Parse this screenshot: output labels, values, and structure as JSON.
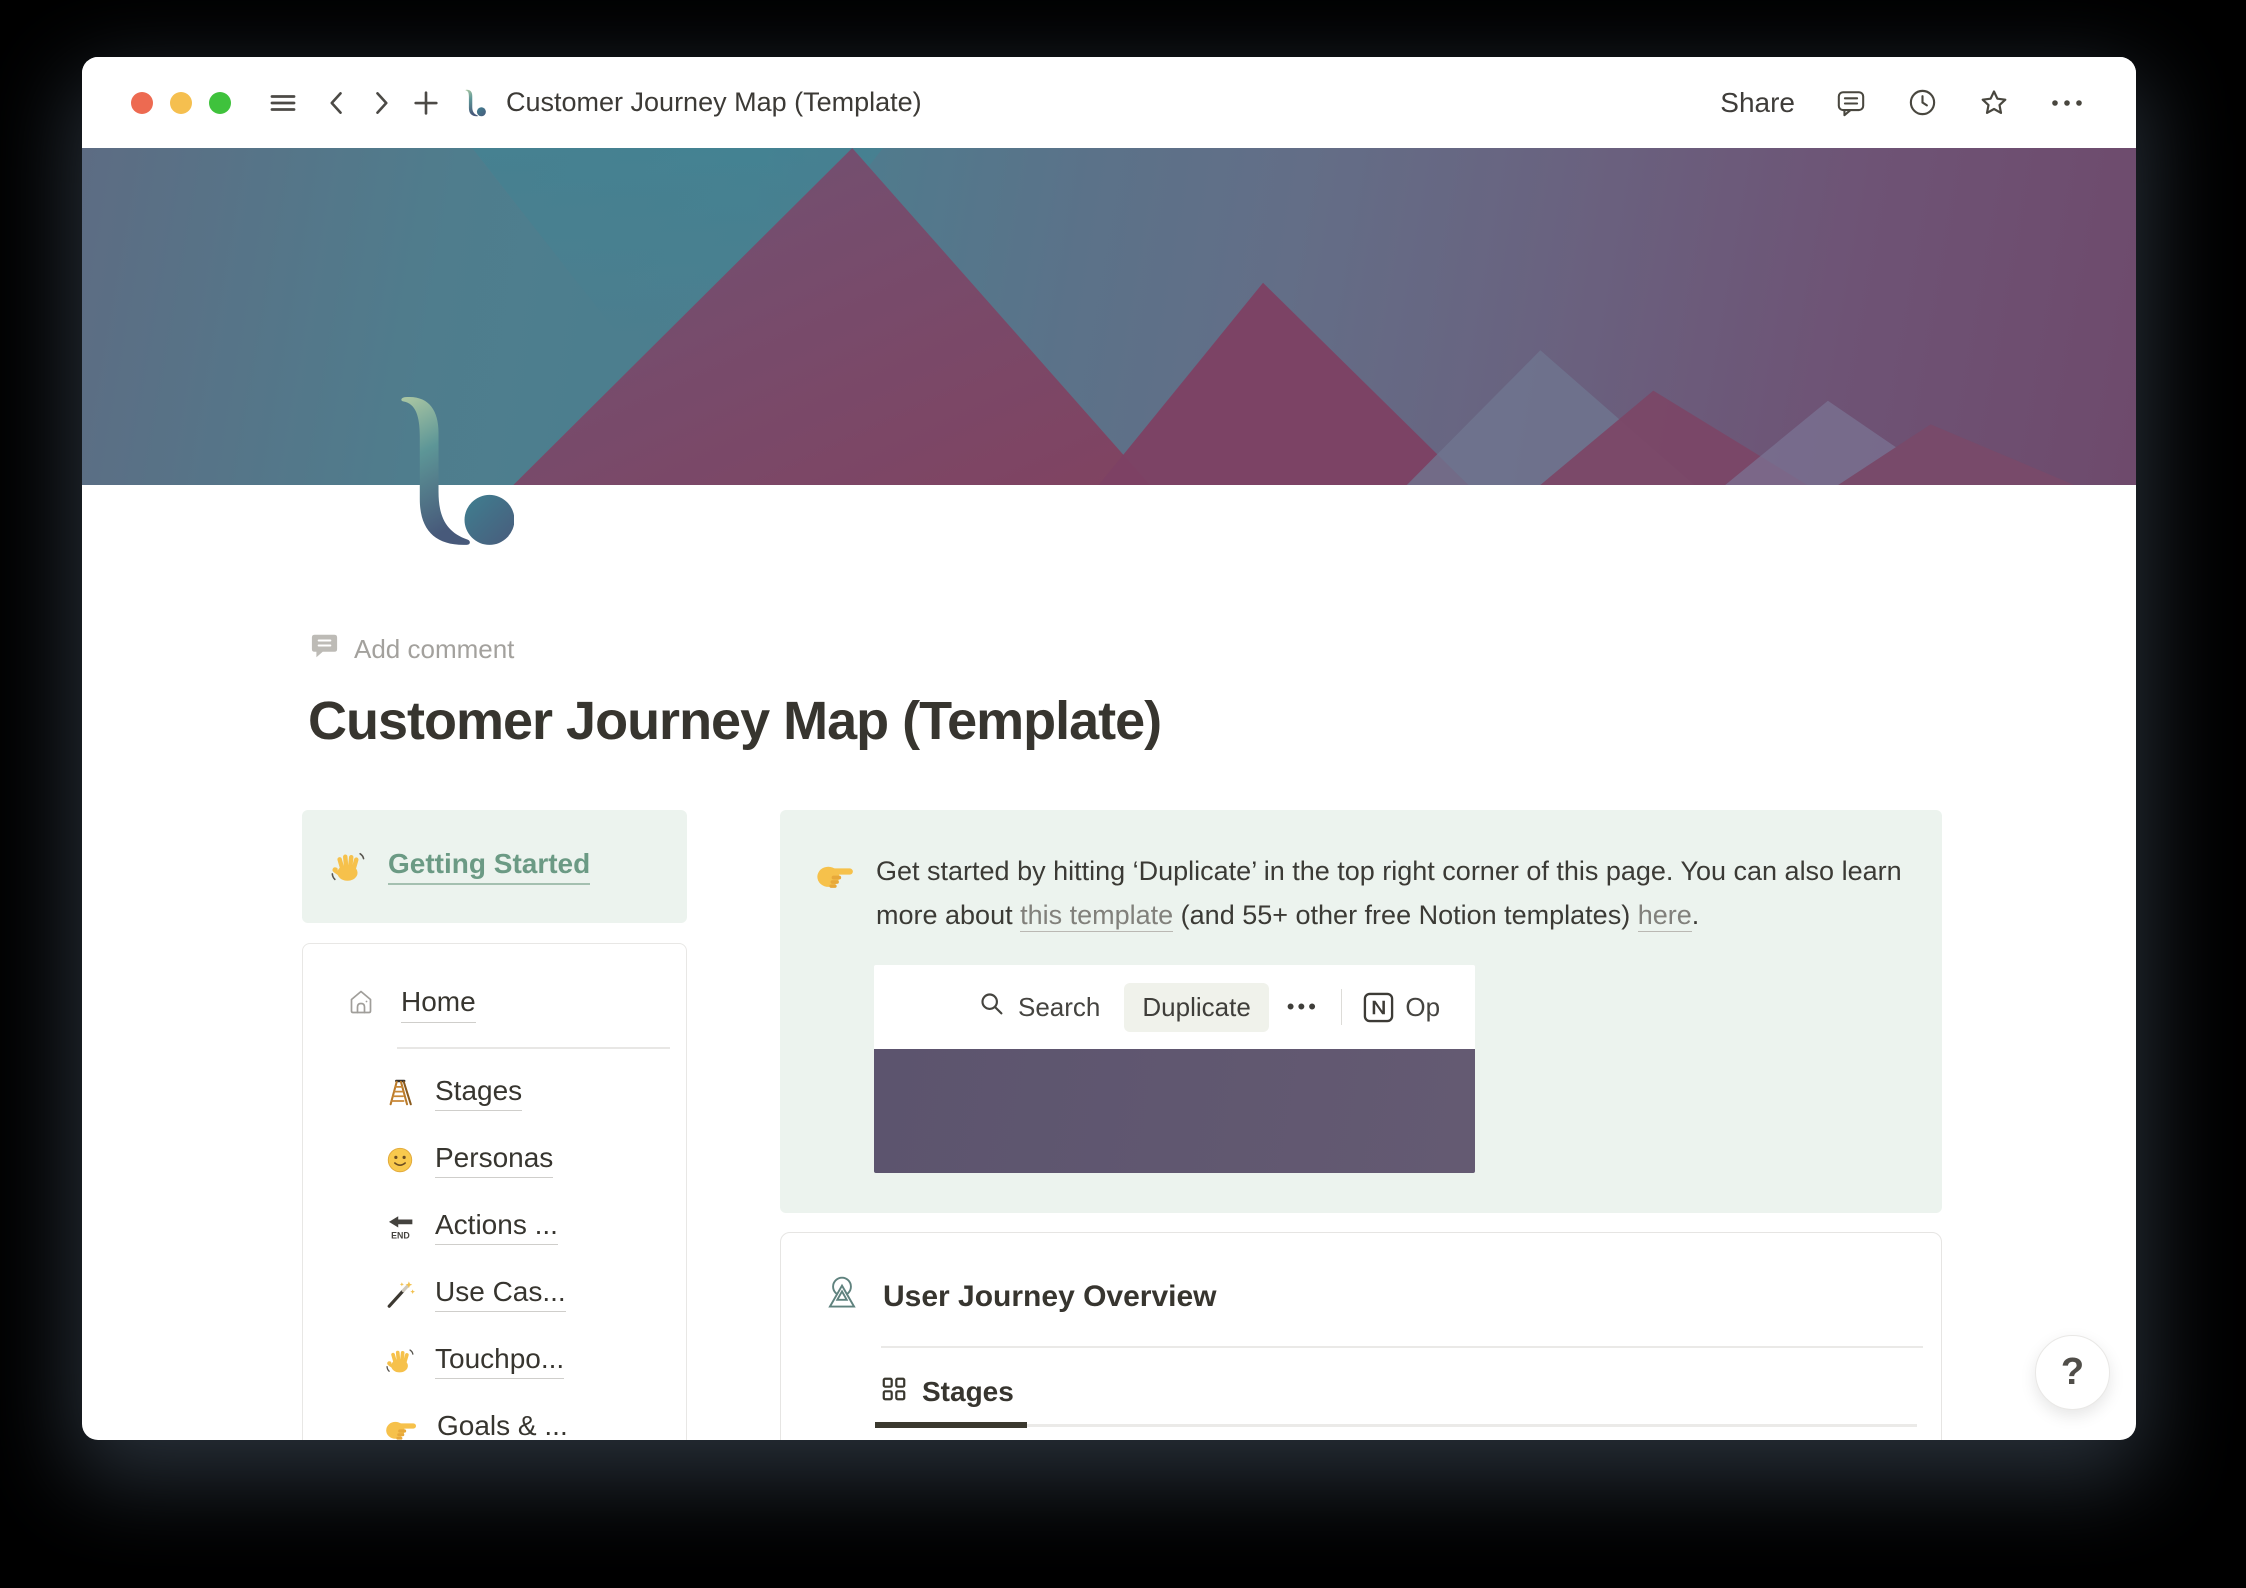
{
  "titlebar": {
    "title": "Customer Journey Map (Template)",
    "share": "Share"
  },
  "page": {
    "add_comment": "Add comment",
    "title": "Customer Journey Map (Template)"
  },
  "left": {
    "getting_started": "Getting Started",
    "home": "Home",
    "items": [
      {
        "icon": "ladder-icon",
        "label": "Stages"
      },
      {
        "icon": "smiley-icon",
        "label": "Personas"
      },
      {
        "icon": "end-arrow-icon",
        "label": "Actions ..."
      },
      {
        "icon": "magic-wand-icon",
        "label": "Use Cas..."
      },
      {
        "icon": "waving-hand-icon",
        "label": "Touchpo..."
      },
      {
        "icon": "pointing-right-icon",
        "label": "Goals & ..."
      }
    ]
  },
  "callout": {
    "before": "Get started by hitting ‘Duplicate’ in the top right corner of this page. You can also learn more about ",
    "link1": "this template",
    "middle": " (and 55+ other free Notion templates) ",
    "link2": "here",
    "after": "."
  },
  "embed": {
    "search": "Search",
    "duplicate": "Duplicate",
    "dots": "•••",
    "open": "Op"
  },
  "card": {
    "title": "User Journey Overview",
    "tab": "Stages"
  },
  "help": {
    "label": "?"
  },
  "colors": {
    "callout_bg": "#ecf3ee",
    "link_green": "#6b9a84",
    "embed_cover_purple": "#5c546e",
    "cover_teal": "#4a7f8f",
    "cover_maroon": "#7d4264"
  }
}
